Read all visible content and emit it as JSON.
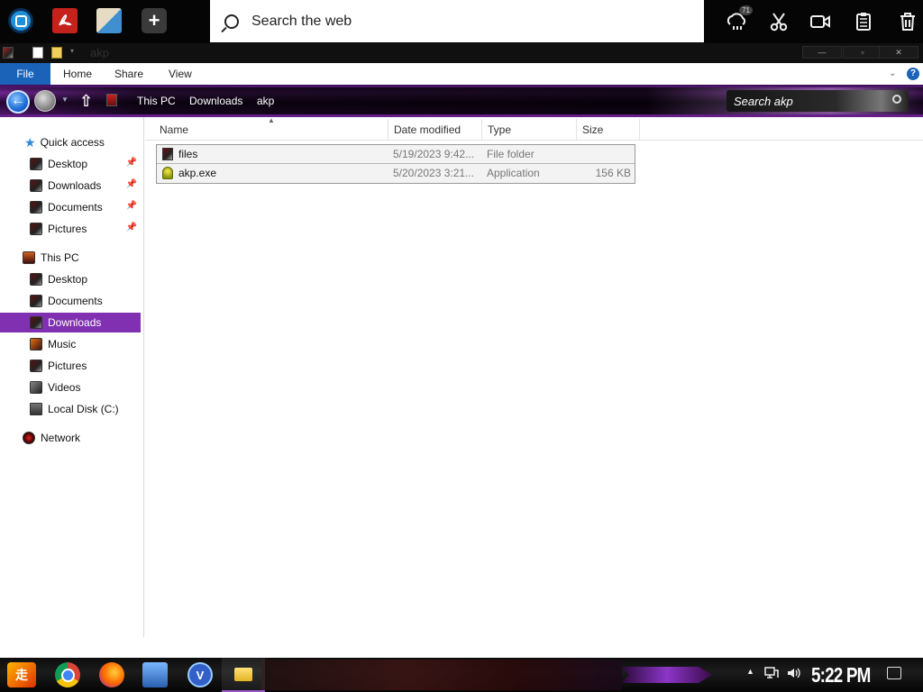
{
  "topbar": {
    "search_placeholder": "Search the web",
    "plus_label": "+",
    "cloud_badge": "71"
  },
  "window": {
    "title": "akp",
    "min": "—",
    "max": "▫",
    "close": "✕"
  },
  "ribbon": {
    "tabs": [
      "File",
      "Home",
      "Share",
      "View"
    ],
    "help": "?"
  },
  "address": {
    "crumbs": [
      "This PC",
      "Downloads",
      "akp"
    ],
    "search_placeholder": "Search akp"
  },
  "nav": {
    "quick_access": "Quick access",
    "quick_items": [
      "Desktop",
      "Downloads",
      "Documents",
      "Pictures"
    ],
    "this_pc": "This PC",
    "pc_items": [
      "Desktop",
      "Documents",
      "Downloads",
      "Music",
      "Pictures",
      "Videos",
      "Local Disk (C:)"
    ],
    "network": "Network",
    "selected": "Downloads"
  },
  "columns": [
    "Name",
    "Date modified",
    "Type",
    "Size"
  ],
  "files": [
    {
      "name": "files",
      "date": "5/19/2023 9:42...",
      "type": "File folder",
      "size": ""
    },
    {
      "name": "akp.exe",
      "date": "5/20/2023 3:21...",
      "type": "Application",
      "size": "156 KB"
    }
  ],
  "taskbar": {
    "start_label": "走",
    "v_label": "V",
    "clock": "5:22 PM"
  },
  "colors": {
    "accent": "#1b63b8",
    "selection": "#8030b0"
  }
}
